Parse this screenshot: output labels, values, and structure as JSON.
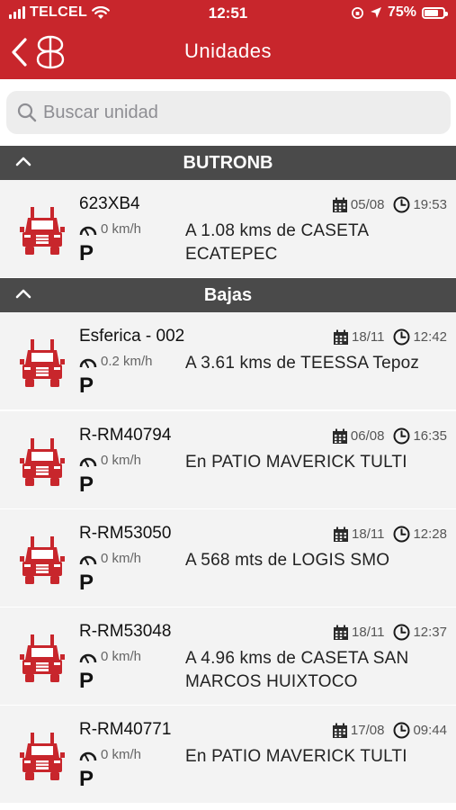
{
  "status_bar": {
    "carrier": "TELCEL",
    "time": "12:51",
    "battery": "75%"
  },
  "nav": {
    "title": "Unidades"
  },
  "search": {
    "placeholder": "Buscar unidad",
    "value": ""
  },
  "colors": {
    "brand_red": "#c8262c",
    "group_header": "#4a4a4a",
    "row_bg": "#f3f3f3"
  },
  "groups": [
    {
      "title": "BUTRONB",
      "units": [
        {
          "name": "623XB4",
          "date": "05/08",
          "time": "19:53",
          "speed": "0 km/h",
          "status": "P",
          "location": "A 1.08 kms de CASETA ECATEPEC"
        }
      ]
    },
    {
      "title": "Bajas",
      "units": [
        {
          "name": "Esferica - 002",
          "date": "18/11",
          "time": "12:42",
          "speed": "0.2 km/h",
          "status": "P",
          "location": "A 3.61 kms de TEESSA Tepoz"
        },
        {
          "name": "R-RM40794",
          "date": "06/08",
          "time": "16:35",
          "speed": "0 km/h",
          "status": "P",
          "location": "En PATIO MAVERICK TULTI"
        },
        {
          "name": "R-RM53050",
          "date": "18/11",
          "time": "12:28",
          "speed": "0 km/h",
          "status": "P",
          "location": "A 568 mts de LOGIS SMO"
        },
        {
          "name": "R-RM53048",
          "date": "18/11",
          "time": "12:37",
          "speed": "0 km/h",
          "status": "P",
          "location": "A 4.96 kms de CASETA SAN MARCOS HUIXTOCO"
        },
        {
          "name": "R-RM40771",
          "date": "17/08",
          "time": "09:44",
          "speed": "0 km/h",
          "status": "P",
          "location": "En PATIO MAVERICK TULTI"
        }
      ]
    }
  ]
}
